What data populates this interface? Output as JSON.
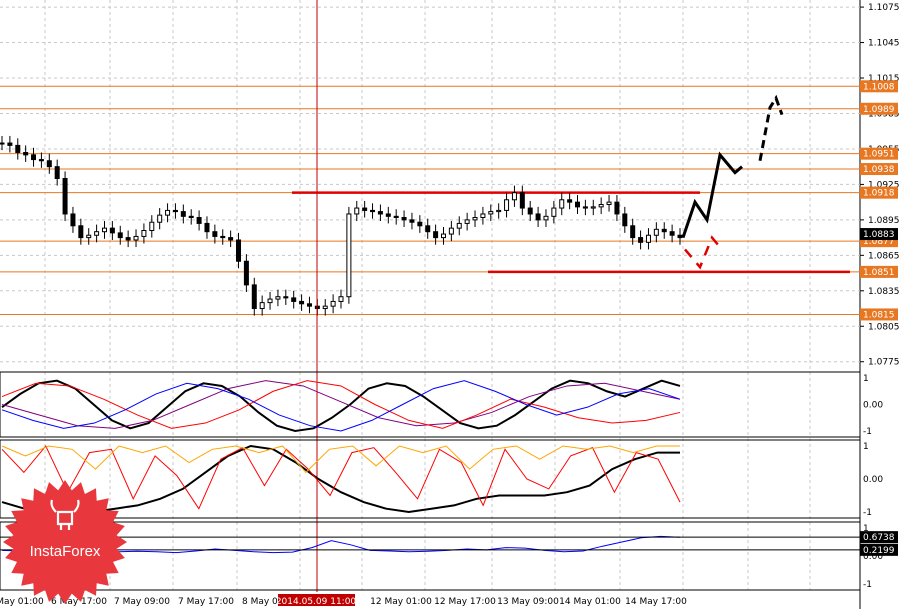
{
  "chart_data": [
    {
      "type": "candlestick",
      "title": "",
      "yticks": [
        "1.1075",
        "1.1045",
        "1.1015",
        "1.0985",
        "1.0955",
        "1.0925",
        "1.0895",
        "1.0865",
        "1.0835",
        "1.0805",
        "1.0775"
      ],
      "ylim": [
        1.0768,
        1.1081
      ],
      "x_labels": [
        "May 01:00",
        "6 May 17:00",
        "7 May 09:00",
        "7 May 17:00",
        "8 May 01:00",
        "8 May 17:00",
        "2014.05.09 11:00",
        "12 May 01:00",
        "12 May 17:00",
        "13 May 09:00",
        "14 May 01:00",
        "14 May 17:00"
      ],
      "crosshair_time": "2014.05.09 11:00",
      "levels": [
        {
          "price": "1.1008",
          "color": "#e87722"
        },
        {
          "price": "1.0989",
          "color": "#e87722"
        },
        {
          "price": "1.0951",
          "color": "#e87722"
        },
        {
          "price": "1.0938",
          "color": "#e87722"
        },
        {
          "price": "1.0918",
          "color": "#e87722"
        },
        {
          "price": "1.0877",
          "color": "#e87722"
        },
        {
          "price": "1.0851",
          "color": "#e87722"
        },
        {
          "price": "1.0815",
          "color": "#e87722"
        }
      ],
      "current_price": "1.0883",
      "resistance_line": 1.0918,
      "support_line": 1.0851,
      "close_series": [
        1.096,
        1.0958,
        1.0952,
        1.095,
        1.0946,
        1.0945,
        1.094,
        1.093,
        1.09,
        1.089,
        1.088,
        1.0882,
        1.0885,
        1.0888,
        1.0884,
        1.088,
        1.0878,
        1.0881,
        1.0886,
        1.0893,
        1.0899,
        1.0903,
        1.0902,
        1.0898,
        1.0897,
        1.0892,
        1.0885,
        1.0881,
        1.088,
        1.0878,
        1.086,
        1.084,
        1.082,
        1.0825,
        1.0828,
        1.083,
        1.0829,
        1.0826,
        1.0824,
        1.0822,
        1.082,
        1.0822,
        1.0826,
        1.083,
        1.09,
        1.0905,
        1.0903,
        1.0902,
        1.09,
        1.0898,
        1.0897,
        1.0895,
        1.0893,
        1.089,
        1.0885,
        1.088,
        1.0883,
        1.0888,
        1.0892,
        1.0895,
        1.0897,
        1.09,
        1.0902,
        1.0903,
        1.0912,
        1.0918,
        1.0905,
        1.09,
        1.0895,
        1.0898,
        1.0905,
        1.0912,
        1.091,
        1.0906,
        1.0905,
        1.0906,
        1.0908,
        1.091,
        1.09,
        1.089,
        1.088,
        1.0876,
        1.0882,
        1.0887,
        1.0885,
        1.0882,
        1.088
      ]
    },
    {
      "type": "line",
      "yticks": [
        "1",
        "0.00",
        "-1"
      ],
      "series": [
        {
          "color": "#000000",
          "values": [
            -0.1,
            0.4,
            0.8,
            0.9,
            0.6,
            0.0,
            -0.6,
            -0.9,
            -0.7,
            -0.1,
            0.5,
            0.8,
            0.7,
            0.3,
            -0.3,
            -0.8,
            -1.0,
            -0.9,
            -0.5,
            0.0,
            0.6,
            0.8,
            0.7,
            0.3,
            -0.2,
            -0.7,
            -0.9,
            -0.8,
            -0.4,
            0.1,
            0.6,
            0.9,
            0.8,
            0.5,
            0.3,
            0.6,
            0.9,
            0.7
          ]
        },
        {
          "color": "#800080",
          "values": [
            0.0,
            -0.4,
            -0.8,
            -0.9,
            -0.6,
            0.0,
            0.6,
            0.9,
            0.7,
            0.1,
            -0.5,
            -0.8,
            -0.7,
            -0.3,
            0.3,
            0.7,
            0.8,
            0.5,
            0.2
          ]
        },
        {
          "color": "#ff0000",
          "values": [
            0.3,
            0.8,
            0.7,
            0.2,
            -0.4,
            -0.9,
            -0.7,
            -0.2,
            0.5,
            0.9,
            0.7,
            0.0,
            -0.6,
            -0.9,
            -0.4,
            0.2,
            -0.1,
            -0.5,
            -0.7,
            -0.6,
            -0.3
          ]
        },
        {
          "color": "#0000ff",
          "values": [
            -0.2,
            -0.6,
            -0.9,
            -0.7,
            -0.2,
            0.4,
            0.8,
            0.6,
            0.2,
            -0.4,
            -0.8,
            -1.0,
            -0.6,
            0.0,
            0.6,
            0.9,
            0.5,
            0.0,
            -0.4,
            -0.1,
            0.4,
            0.6,
            0.2
          ]
        }
      ]
    },
    {
      "type": "line",
      "yticks": [
        "1",
        "0.00",
        "-1"
      ],
      "series": [
        {
          "color": "#000000",
          "values": [
            -0.7,
            -0.9,
            -1.0,
            -1.0,
            -1.0,
            -0.9,
            -0.8,
            -0.6,
            -0.3,
            0.2,
            0.7,
            1.0,
            0.9,
            0.5,
            0.0,
            -0.4,
            -0.7,
            -0.9,
            -1.0,
            -0.9,
            -0.8,
            -0.6,
            -0.5,
            -0.5,
            -0.5,
            -0.4,
            -0.2,
            0.3,
            0.6,
            0.8,
            0.8
          ]
        },
        {
          "color": "#ff0000",
          "values": [
            0.9,
            0.2,
            1.0,
            -0.4,
            0.8,
            0.9,
            -0.6,
            0.7,
            0.1,
            -0.9,
            0.6,
            0.95,
            -0.2,
            0.9,
            0.3,
            -0.5,
            0.8,
            0.95,
            0.2,
            -0.6,
            0.9,
            0.5,
            -0.8,
            0.9,
            0.0,
            -0.3,
            0.7,
            0.95,
            -0.4,
            0.8,
            0.6,
            -0.7
          ]
        },
        {
          "color": "#ffa500",
          "values": [
            1.0,
            0.7,
            1.0,
            0.9,
            0.3,
            1.0,
            0.8,
            1.0,
            0.5,
            0.9,
            1.0,
            0.8,
            1.0,
            0.2,
            0.9,
            1.0,
            0.4,
            1.0,
            0.8,
            1.0,
            0.3,
            0.9,
            1.0,
            0.6,
            1.0,
            0.9,
            1.0,
            0.8,
            1.0,
            1.0
          ]
        }
      ]
    },
    {
      "type": "line",
      "yticks": [
        "1",
        "0.00",
        "-1"
      ],
      "badges": [
        "0.6738",
        "0.2199"
      ],
      "series": [
        {
          "color": "#0000ff",
          "values": [
            0.2,
            0.18,
            0.15,
            0.12,
            0.1,
            0.12,
            0.15,
            0.17,
            0.15,
            0.12,
            0.18,
            0.25,
            0.2,
            0.15,
            0.12,
            0.14,
            0.3,
            0.55,
            0.4,
            0.2,
            0.18,
            0.15,
            0.17,
            0.2,
            0.25,
            0.22,
            0.3,
            0.28,
            0.2,
            0.15,
            0.18,
            0.35,
            0.5,
            0.65,
            0.7,
            0.67
          ]
        }
      ]
    }
  ],
  "logo": {
    "text": "InstaForex"
  }
}
